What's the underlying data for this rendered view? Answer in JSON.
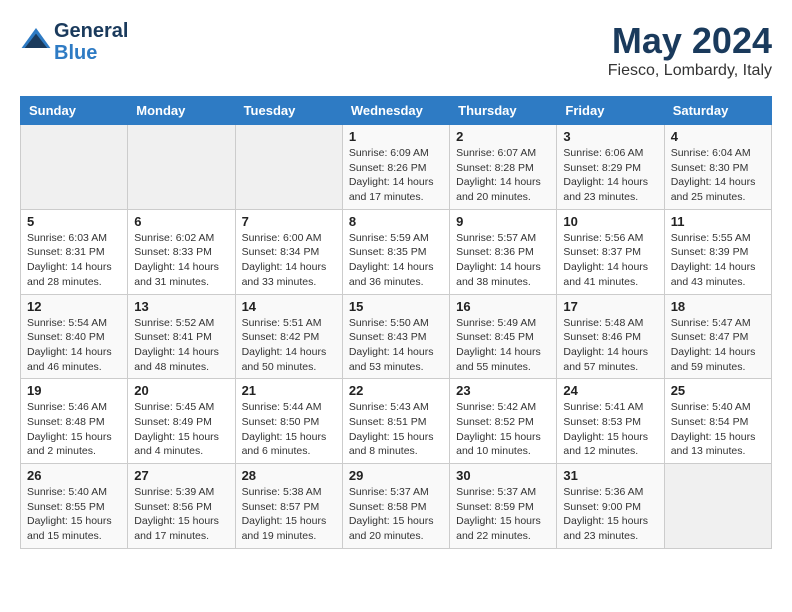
{
  "logo": {
    "line1": "General",
    "line2": "Blue"
  },
  "title": "May 2024",
  "subtitle": "Fiesco, Lombardy, Italy",
  "days_header": [
    "Sunday",
    "Monday",
    "Tuesday",
    "Wednesday",
    "Thursday",
    "Friday",
    "Saturday"
  ],
  "weeks": [
    [
      {
        "day": "",
        "detail": ""
      },
      {
        "day": "",
        "detail": ""
      },
      {
        "day": "",
        "detail": ""
      },
      {
        "day": "1",
        "detail": "Sunrise: 6:09 AM\nSunset: 8:26 PM\nDaylight: 14 hours\nand 17 minutes."
      },
      {
        "day": "2",
        "detail": "Sunrise: 6:07 AM\nSunset: 8:28 PM\nDaylight: 14 hours\nand 20 minutes."
      },
      {
        "day": "3",
        "detail": "Sunrise: 6:06 AM\nSunset: 8:29 PM\nDaylight: 14 hours\nand 23 minutes."
      },
      {
        "day": "4",
        "detail": "Sunrise: 6:04 AM\nSunset: 8:30 PM\nDaylight: 14 hours\nand 25 minutes."
      }
    ],
    [
      {
        "day": "5",
        "detail": "Sunrise: 6:03 AM\nSunset: 8:31 PM\nDaylight: 14 hours\nand 28 minutes."
      },
      {
        "day": "6",
        "detail": "Sunrise: 6:02 AM\nSunset: 8:33 PM\nDaylight: 14 hours\nand 31 minutes."
      },
      {
        "day": "7",
        "detail": "Sunrise: 6:00 AM\nSunset: 8:34 PM\nDaylight: 14 hours\nand 33 minutes."
      },
      {
        "day": "8",
        "detail": "Sunrise: 5:59 AM\nSunset: 8:35 PM\nDaylight: 14 hours\nand 36 minutes."
      },
      {
        "day": "9",
        "detail": "Sunrise: 5:57 AM\nSunset: 8:36 PM\nDaylight: 14 hours\nand 38 minutes."
      },
      {
        "day": "10",
        "detail": "Sunrise: 5:56 AM\nSunset: 8:37 PM\nDaylight: 14 hours\nand 41 minutes."
      },
      {
        "day": "11",
        "detail": "Sunrise: 5:55 AM\nSunset: 8:39 PM\nDaylight: 14 hours\nand 43 minutes."
      }
    ],
    [
      {
        "day": "12",
        "detail": "Sunrise: 5:54 AM\nSunset: 8:40 PM\nDaylight: 14 hours\nand 46 minutes."
      },
      {
        "day": "13",
        "detail": "Sunrise: 5:52 AM\nSunset: 8:41 PM\nDaylight: 14 hours\nand 48 minutes."
      },
      {
        "day": "14",
        "detail": "Sunrise: 5:51 AM\nSunset: 8:42 PM\nDaylight: 14 hours\nand 50 minutes."
      },
      {
        "day": "15",
        "detail": "Sunrise: 5:50 AM\nSunset: 8:43 PM\nDaylight: 14 hours\nand 53 minutes."
      },
      {
        "day": "16",
        "detail": "Sunrise: 5:49 AM\nSunset: 8:45 PM\nDaylight: 14 hours\nand 55 minutes."
      },
      {
        "day": "17",
        "detail": "Sunrise: 5:48 AM\nSunset: 8:46 PM\nDaylight: 14 hours\nand 57 minutes."
      },
      {
        "day": "18",
        "detail": "Sunrise: 5:47 AM\nSunset: 8:47 PM\nDaylight: 14 hours\nand 59 minutes."
      }
    ],
    [
      {
        "day": "19",
        "detail": "Sunrise: 5:46 AM\nSunset: 8:48 PM\nDaylight: 15 hours\nand 2 minutes."
      },
      {
        "day": "20",
        "detail": "Sunrise: 5:45 AM\nSunset: 8:49 PM\nDaylight: 15 hours\nand 4 minutes."
      },
      {
        "day": "21",
        "detail": "Sunrise: 5:44 AM\nSunset: 8:50 PM\nDaylight: 15 hours\nand 6 minutes."
      },
      {
        "day": "22",
        "detail": "Sunrise: 5:43 AM\nSunset: 8:51 PM\nDaylight: 15 hours\nand 8 minutes."
      },
      {
        "day": "23",
        "detail": "Sunrise: 5:42 AM\nSunset: 8:52 PM\nDaylight: 15 hours\nand 10 minutes."
      },
      {
        "day": "24",
        "detail": "Sunrise: 5:41 AM\nSunset: 8:53 PM\nDaylight: 15 hours\nand 12 minutes."
      },
      {
        "day": "25",
        "detail": "Sunrise: 5:40 AM\nSunset: 8:54 PM\nDaylight: 15 hours\nand 13 minutes."
      }
    ],
    [
      {
        "day": "26",
        "detail": "Sunrise: 5:40 AM\nSunset: 8:55 PM\nDaylight: 15 hours\nand 15 minutes."
      },
      {
        "day": "27",
        "detail": "Sunrise: 5:39 AM\nSunset: 8:56 PM\nDaylight: 15 hours\nand 17 minutes."
      },
      {
        "day": "28",
        "detail": "Sunrise: 5:38 AM\nSunset: 8:57 PM\nDaylight: 15 hours\nand 19 minutes."
      },
      {
        "day": "29",
        "detail": "Sunrise: 5:37 AM\nSunset: 8:58 PM\nDaylight: 15 hours\nand 20 minutes."
      },
      {
        "day": "30",
        "detail": "Sunrise: 5:37 AM\nSunset: 8:59 PM\nDaylight: 15 hours\nand 22 minutes."
      },
      {
        "day": "31",
        "detail": "Sunrise: 5:36 AM\nSunset: 9:00 PM\nDaylight: 15 hours\nand 23 minutes."
      },
      {
        "day": "",
        "detail": ""
      }
    ]
  ]
}
